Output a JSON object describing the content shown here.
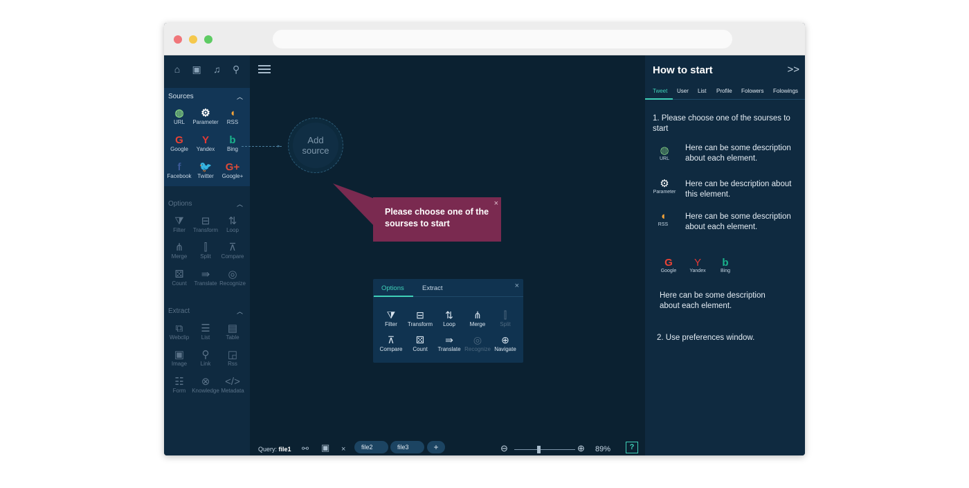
{
  "sidebar": {
    "top_icons": [
      "home-icon",
      "contacts-icon",
      "bell-icon",
      "search-icon"
    ],
    "sources": {
      "title": "Sources",
      "items": [
        {
          "label": "URL",
          "glyph": "◍",
          "color": "#7ec77f"
        },
        {
          "label": "Parameter",
          "glyph": "⚙",
          "color": "#ffffff"
        },
        {
          "label": "RSS",
          "glyph": "◖",
          "color": "#f2a33a"
        },
        {
          "label": "Google",
          "glyph": "G",
          "color": "#ea4335"
        },
        {
          "label": "Yandex",
          "glyph": "Y",
          "color": "#e53935"
        },
        {
          "label": "Bing",
          "glyph": "b",
          "color": "#1ab28c"
        },
        {
          "label": "Facebook",
          "glyph": "f",
          "color": "#3b5998"
        },
        {
          "label": "Twitter",
          "glyph": "🐦",
          "color": "#1da1f2"
        },
        {
          "label": "Google+",
          "glyph": "G+",
          "color": "#dd4b39"
        }
      ]
    },
    "options": {
      "title": "Options",
      "items": [
        {
          "label": "Filter",
          "glyph": "⧩"
        },
        {
          "label": "Transform",
          "glyph": "⊟"
        },
        {
          "label": "Loop",
          "glyph": "⇅"
        },
        {
          "label": "Merge",
          "glyph": "⋔"
        },
        {
          "label": "Split",
          "glyph": "⫿"
        },
        {
          "label": "Compare",
          "glyph": "⊼"
        },
        {
          "label": "Count",
          "glyph": "⚄"
        },
        {
          "label": "Translate",
          "glyph": "⇛"
        },
        {
          "label": "Recognize",
          "glyph": "◎"
        }
      ]
    },
    "extract": {
      "title": "Extract",
      "items": [
        {
          "label": "Webclip",
          "glyph": "⧉"
        },
        {
          "label": "List",
          "glyph": "☰"
        },
        {
          "label": "Table",
          "glyph": "▤"
        },
        {
          "label": "Image",
          "glyph": "▣"
        },
        {
          "label": "Link",
          "glyph": "⚲"
        },
        {
          "label": "Rss",
          "glyph": "◲"
        },
        {
          "label": "Form",
          "glyph": "☷"
        },
        {
          "label": "Knowledge",
          "glyph": "⊗"
        },
        {
          "label": "Metadata",
          "glyph": "</>"
        }
      ]
    }
  },
  "canvas": {
    "add_source_line1": "Add",
    "add_source_line2": "source",
    "tooltip_text": "Please choose one of the sourses to start",
    "tooltip_close": "×"
  },
  "options_panel": {
    "tabs": [
      "Options",
      "Extract"
    ],
    "close": "×",
    "items": [
      {
        "label": "Filter",
        "glyph": "⧩",
        "disabled": false
      },
      {
        "label": "Transform",
        "glyph": "⊟",
        "disabled": false
      },
      {
        "label": "Loop",
        "glyph": "⇅",
        "disabled": false
      },
      {
        "label": "Merge",
        "glyph": "⋔",
        "disabled": false
      },
      {
        "label": "Split",
        "glyph": "⫿",
        "disabled": true
      },
      {
        "label": "Compare",
        "glyph": "⊼",
        "disabled": false
      },
      {
        "label": "Count",
        "glyph": "⚄",
        "disabled": false
      },
      {
        "label": "Translate",
        "glyph": "⇛",
        "disabled": false
      },
      {
        "label": "Recognize",
        "glyph": "◎",
        "disabled": true
      },
      {
        "label": "Navigate",
        "glyph": "⊕",
        "disabled": false
      }
    ]
  },
  "right_panel": {
    "title": "How to start",
    "collapse": ">>",
    "tabs": [
      "Tweet",
      "User",
      "List",
      "Profile",
      "Folowers",
      "Folowings"
    ],
    "step1": "1. Please choose one of the sourses to start",
    "desc_url": "Here can be some description about each element.",
    "desc_parameter": "Here can be  description about this element.",
    "desc_rss": "Here can be some description about each element.",
    "icon_url": "URL",
    "icon_parameter": "Parameter",
    "icon_rss": "RSS",
    "icon_google": "Google",
    "icon_yandex": "Yandex",
    "icon_bing": "Bing",
    "desc_search": "Here can be some description about each element.",
    "step2": "2. Use preferences window."
  },
  "bottom_bar": {
    "query_label": "Query:",
    "query_file": "file1",
    "close_tab": "×",
    "tabs": [
      "file2",
      "file3"
    ],
    "add_tab": "+",
    "zoom_minus": "⊖",
    "zoom_plus": "⊕",
    "zoom_level": "89%",
    "zoom_fraction": 0.37,
    "help": "?"
  },
  "colors": {
    "accent": "#3fd1b8",
    "tooltip_bg": "#7a2a50",
    "panel_bg": "#0f2a40",
    "canvas_bg": "#0b2131"
  }
}
